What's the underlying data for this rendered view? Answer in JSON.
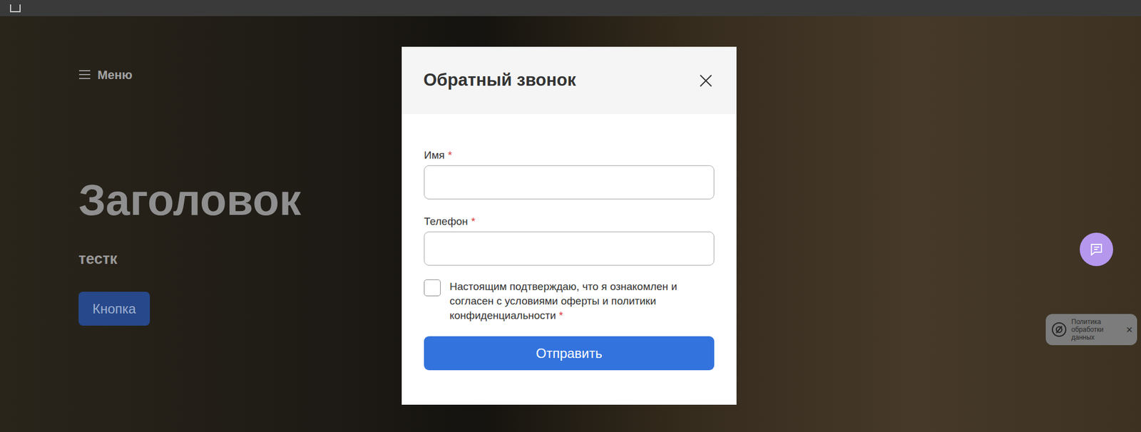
{
  "menu": {
    "label": "Меню"
  },
  "hero": {
    "title": "Заголовок",
    "subtitle": "тестк",
    "button": "Кнопка"
  },
  "modal": {
    "title": "Обратный звонок",
    "required_mark": "*",
    "fields": [
      {
        "label": "Имя",
        "required": true,
        "value": ""
      },
      {
        "label": "Телефон",
        "required": true,
        "value": ""
      }
    ],
    "consent": {
      "text": "Настоящим подтверждаю, что я ознакомлен и согласен с условиями оферты и политики конфиденциальности",
      "checked": false,
      "required": true
    },
    "submit": "Отправить"
  },
  "cookie": {
    "text": "Политика обработки данных",
    "close": "×"
  }
}
